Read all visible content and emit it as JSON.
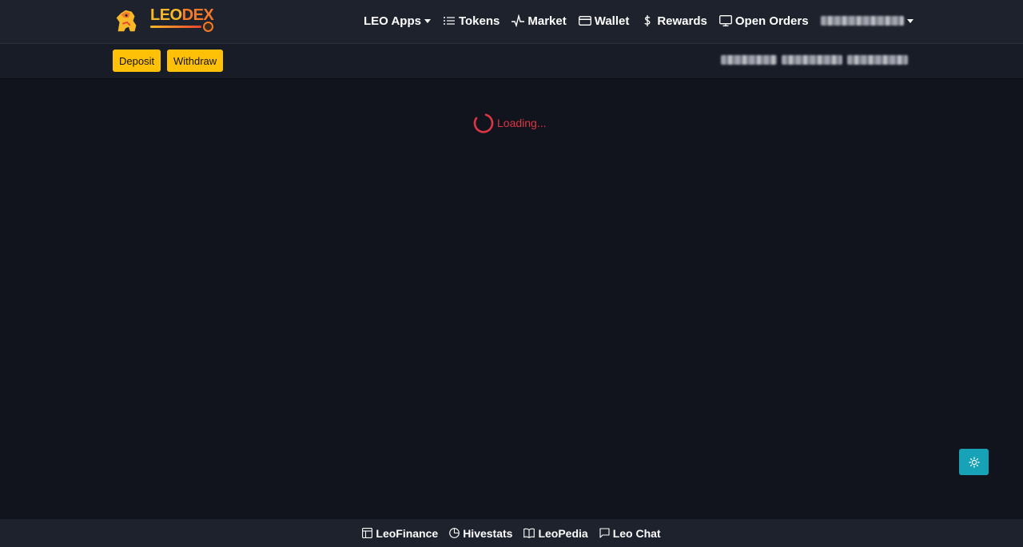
{
  "brand": {
    "logo_text_part1": "LEO",
    "logo_text_part2": "DEX",
    "logo_icon": "lion-logo-icon",
    "colors": {
      "yellow": "#f7b928",
      "orange": "#f47a2a",
      "red": "#e8442d"
    }
  },
  "nav": {
    "items": [
      {
        "label": "LEO Apps",
        "icon": "",
        "dropdown": true
      },
      {
        "label": "Tokens",
        "icon": "list-icon"
      },
      {
        "label": "Market",
        "icon": "activity-icon"
      },
      {
        "label": "Wallet",
        "icon": "wallet-icon"
      },
      {
        "label": "Rewards",
        "icon": "dollar-icon"
      },
      {
        "label": "Open Orders",
        "icon": "monitor-icon"
      }
    ],
    "user_menu": {
      "icon": "chevron-down-icon"
    }
  },
  "subbar": {
    "deposit_label": "Deposit",
    "withdraw_label": "Withdraw"
  },
  "main": {
    "loading_text": "Loading...",
    "loading_color": "#dc3545"
  },
  "theme_toggle": {
    "icon": "sun-icon",
    "color": "#17a2b8"
  },
  "footer": {
    "links": [
      {
        "label": "LeoFinance",
        "icon": "layout-icon"
      },
      {
        "label": "Hivestats",
        "icon": "pie-chart-icon"
      },
      {
        "label": "LeoPedia",
        "icon": "book-icon"
      },
      {
        "label": "Leo Chat",
        "icon": "chat-bubble-icon"
      }
    ]
  }
}
